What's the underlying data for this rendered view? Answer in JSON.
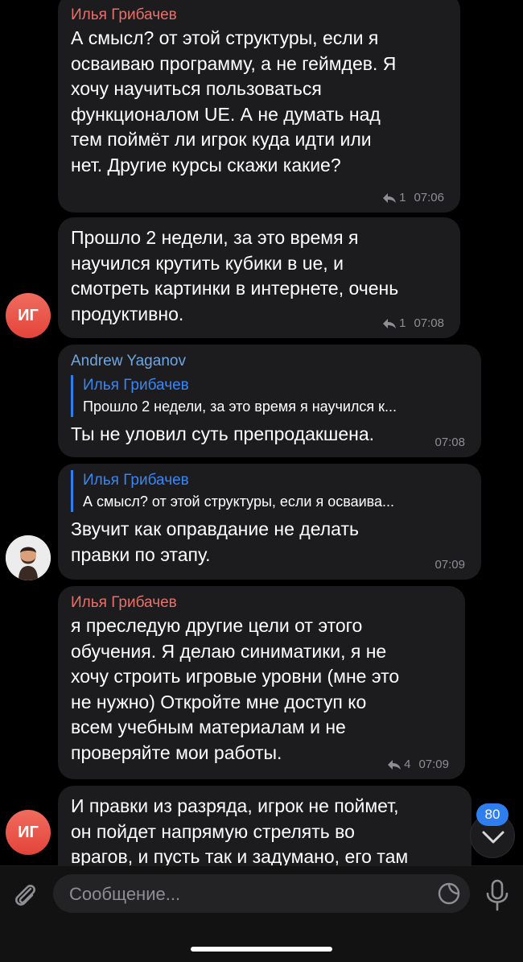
{
  "messages": [
    {
      "sender": "Илья Грибачев",
      "text": "А смысл? от этой структуры, если я\nосваиваю программу, а не геймдев. Я\nхочу научиться пользоваться\nфункционалом UE. А не думать над\nтем поймёт ли игрок куда идти или\nнет. Другие курсы скажи какие?",
      "replies": "1",
      "time": "07:06"
    },
    {
      "text": "Прошло 2 недели, за это время я\nнаучился крутить кубики в ue, и\nсмотреть картинки в интернете, очень\nпродуктивно.",
      "replies": "1",
      "time": "07:08",
      "avatar_initials": "ИГ"
    },
    {
      "sender": "Andrew Yaganov",
      "quote_name": "Илья Грибачев",
      "quote_text": "Прошло 2 недели, за это время я научился к...",
      "text": "Ты не уловил суть препродакшена.",
      "time": "07:08"
    },
    {
      "quote_name": "Илья Грибачев",
      "quote_text": "А смысл? от этой структуры, если я осваива...",
      "text": "Звучит как оправдание не делать\nправки по этапу.",
      "time": "07:09"
    },
    {
      "sender": "Илья Грибачев",
      "text": "я преследую другие цели от этого\nобучения. Я делаю синиматики, я не\nхочу строить игровые уровни (мне это\nне нужно) Откройте мне доступ ко\nвсем учебным материалам и не\nпроверяйте мои работы.",
      "replies": "4",
      "time": "07:09"
    },
    {
      "text": "И правки из разряда, игрок не поймет,\nон пойдет напрямую стрелять во\nврагов, и пусть так и задумано, его там",
      "avatar_initials": "ИГ"
    }
  ],
  "unread_count": "80",
  "composer": {
    "placeholder": "Сообщение..."
  },
  "icons": [
    "paperclip-icon",
    "sticker-icon",
    "microphone-icon",
    "reply-arrow-icon",
    "chevron-down-icon"
  ],
  "colors": {
    "background": "#000000",
    "bubble": "#1c1c1e",
    "sender_red": "#e9706a",
    "sender_blue": "#6ea6e3",
    "accent": "#2f7ef0"
  }
}
